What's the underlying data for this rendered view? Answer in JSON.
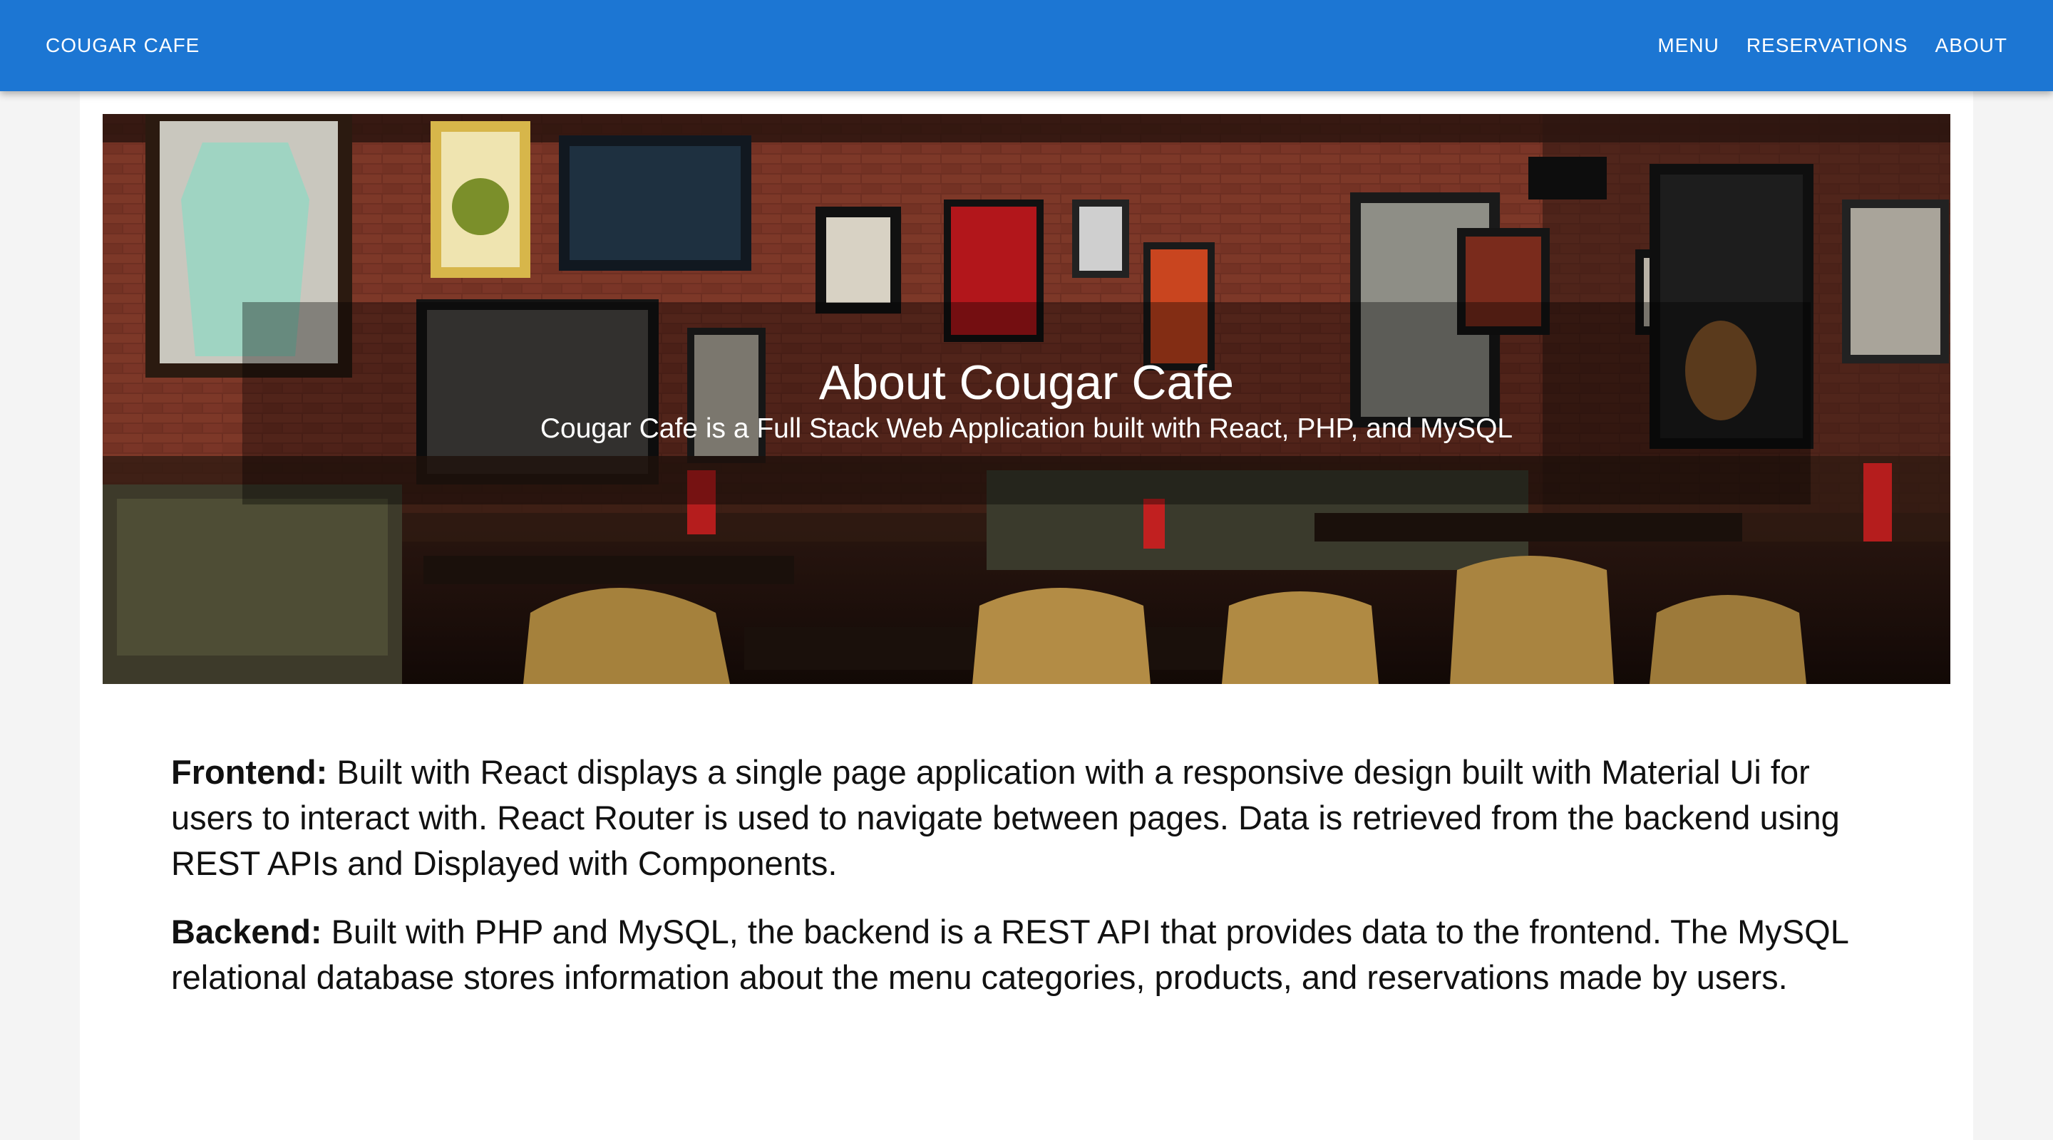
{
  "appbar": {
    "brand": "COUGAR CAFE",
    "nav": [
      "MENU",
      "RESERVATIONS",
      "ABOUT"
    ],
    "color": "#1c76d3"
  },
  "hero": {
    "title": "About Cougar Cafe",
    "subtitle": "Cougar Cafe is a Full Stack Web Application built with React, PHP, and MySQL",
    "image": "restaurant-interior-photo"
  },
  "content": {
    "frontend": {
      "label": "Frontend:",
      "text": " Built with React displays a single page application with a responsive design built with Material Ui for users to interact with. React Router is used to navigate between pages. Data is retrieved from the backend using REST APIs and Displayed with Components."
    },
    "backend": {
      "label": "Backend:",
      "text": " Built with PHP and MySQL, the backend is a REST API that provides data to the frontend. The MySQL relational database stores information about the menu categories, products, and reservations made by users."
    }
  }
}
